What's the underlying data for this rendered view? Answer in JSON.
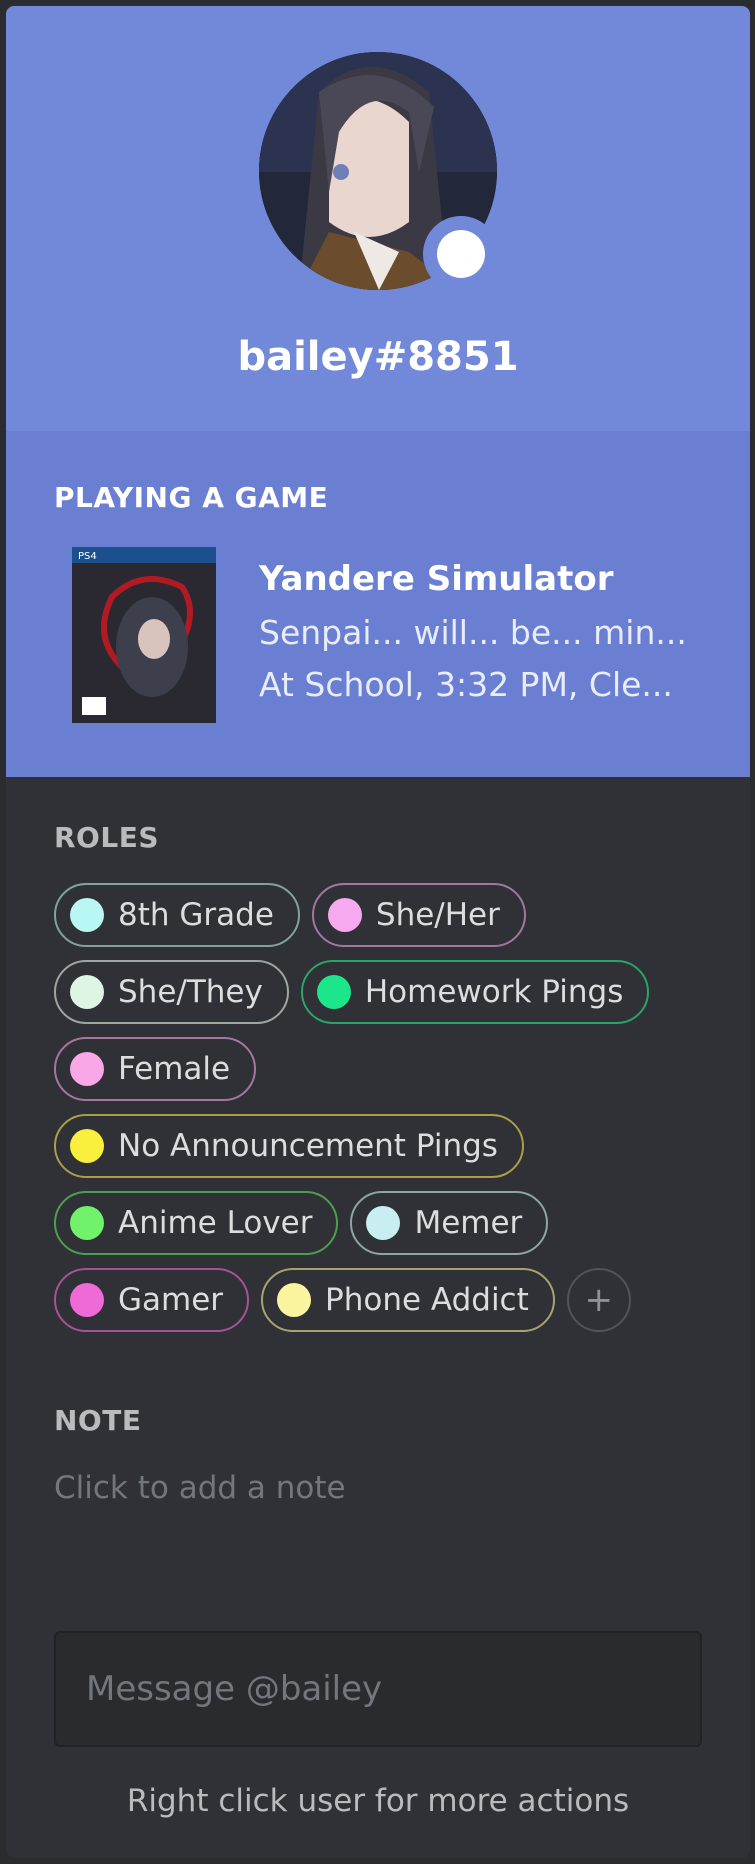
{
  "user": {
    "tag": "bailey#8851",
    "status": "online",
    "status_color": "#ffffff"
  },
  "activity": {
    "section_title": "PLAYING A GAME",
    "game_name": "Yandere Simulator",
    "details": "Senpai... will... be... min...",
    "state": "At School, 3:32 PM, Cle..."
  },
  "roles": {
    "section_title": "ROLES",
    "items": [
      {
        "label": "8th Grade",
        "color": "#b9f7f5",
        "border": "#7fa3a0"
      },
      {
        "label": "She/Her",
        "color": "#f6a9ee",
        "border": "#a276a2"
      },
      {
        "label": "She/They",
        "color": "#dff5e4",
        "border": "#9ea6a0"
      },
      {
        "label": "Homework Pings",
        "color": "#1de68a",
        "border": "#2aa469"
      },
      {
        "label": "Female",
        "color": "#f9a7e7",
        "border": "#a576a0"
      },
      {
        "label": "No Announcement Pings",
        "color": "#f8f03c",
        "border": "#a6a04a"
      },
      {
        "label": "Anime Lover",
        "color": "#71f26a",
        "border": "#4f9e4d"
      },
      {
        "label": "Memer",
        "color": "#c9eef2",
        "border": "#8ea4a6"
      },
      {
        "label": "Gamer",
        "color": "#ef6ad7",
        "border": "#a65296"
      },
      {
        "label": "Phone Addict",
        "color": "#fbf49f",
        "border": "#a6a36e"
      }
    ],
    "add_icon": "plus-icon"
  },
  "note": {
    "section_title": "NOTE",
    "placeholder": "Click to add a note"
  },
  "message": {
    "placeholder": "Message @bailey"
  },
  "footer": {
    "hint": "Right click user for more actions"
  },
  "colors": {
    "header_bg": "#7289da",
    "activity_bg": "#6a7fd2",
    "body_bg": "#2f3136"
  }
}
